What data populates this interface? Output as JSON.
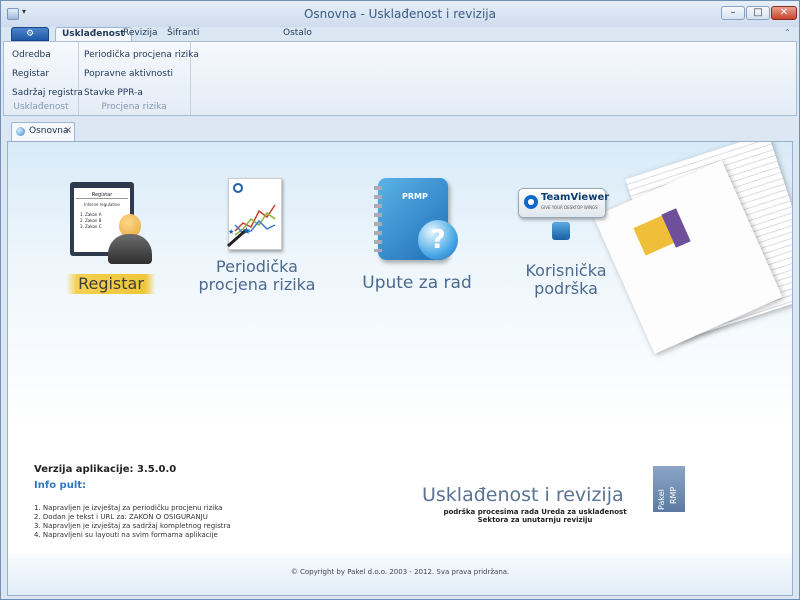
{
  "window": {
    "title": "Osnovna - Usklađenost i revizija"
  },
  "ribbon_tabs": [
    "Usklađenost",
    "Revizija",
    "Šifranti",
    "Ostalo"
  ],
  "ribbon": {
    "groups": [
      {
        "title": "Usklađenost",
        "items": [
          "Odredba",
          "Registar",
          "Sadržaj registra"
        ]
      },
      {
        "title": "Procjena rizika",
        "items": [
          "Periodička procjena rizika",
          "Popravne aktivnosti",
          "Stavke PPR-a"
        ]
      }
    ]
  },
  "doc_tab": {
    "label": "Osnovna"
  },
  "tiles": {
    "registar": {
      "label": "Registar",
      "clip_title": "Registar",
      "clip_sub": "Interne regulative",
      "clip_lines": "1. Zakon A\n2. Zakon B\n3. Zakon C"
    },
    "periodicka": {
      "label_line1": "Periodička",
      "label_line2": "procjena rizika"
    },
    "upute": {
      "label": "Upute za rad",
      "book_title": "PRMP"
    },
    "korisnicka": {
      "label_line1": "Korisnička",
      "label_line2": "podrška",
      "tv_name": "TeamViewer",
      "tv_tag": "GIVE YOUR DESKTOP WINGS"
    }
  },
  "info": {
    "version": "Verzija aplikacije: 3.5.0.0",
    "info_title": "Info pult:",
    "items": [
      "1. Napravljen je izvještaj za periodičku procjenu rizika",
      "2. Dodan je tekst i URL za: ZAKON O OSIGURANJU",
      "3. Napravljen je izvještaj za sadržaj kompletnog registra",
      "4. Napravljeni su layouti na svim formama aplikacije"
    ]
  },
  "brand": {
    "title": "Usklađenost i revizija",
    "sub1": "podrška procesima rada Ureda za usklađenost",
    "sub2": "Sektora za unutarnju reviziju",
    "logo_text1": "Pakel",
    "logo_text2": "RMP"
  },
  "footer": {
    "copyright": "© Copyright by Pakel d.o.o. 2003 - 2012. Sva prava pridržana."
  },
  "colors": {
    "accent": "#2f78c0",
    "tile_text": "#4b6a8e",
    "highlight": "#f0c63a"
  }
}
